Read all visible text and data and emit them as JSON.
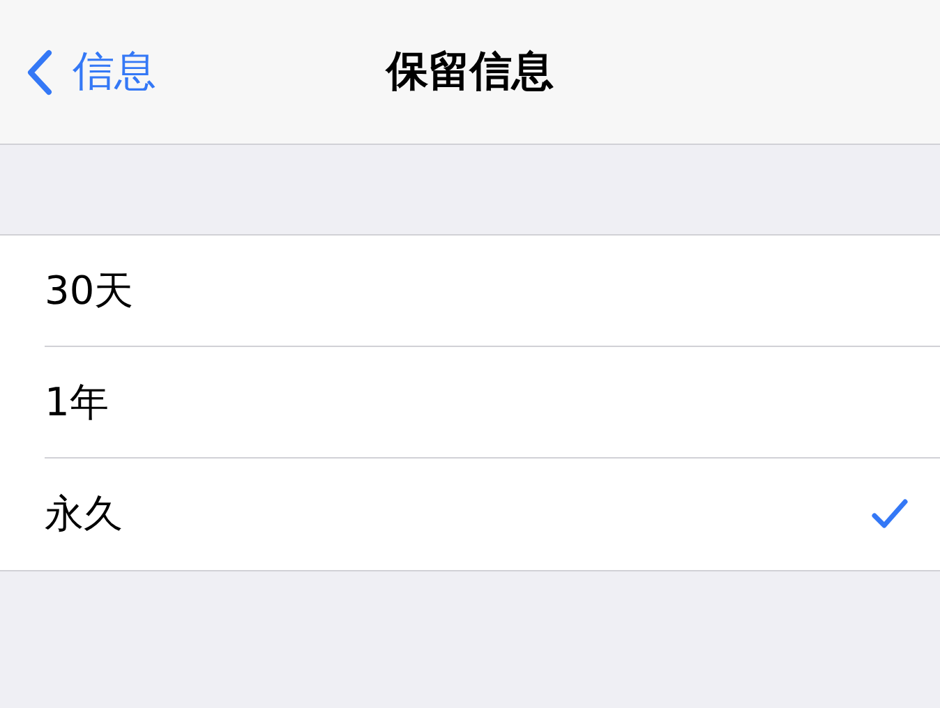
{
  "nav_bar": {
    "back_label": "信息",
    "title": "保留信息"
  },
  "options": [
    {
      "label": "30天",
      "selected": false
    },
    {
      "label": "1年",
      "selected": false
    },
    {
      "label": "永久",
      "selected": true
    }
  ]
}
